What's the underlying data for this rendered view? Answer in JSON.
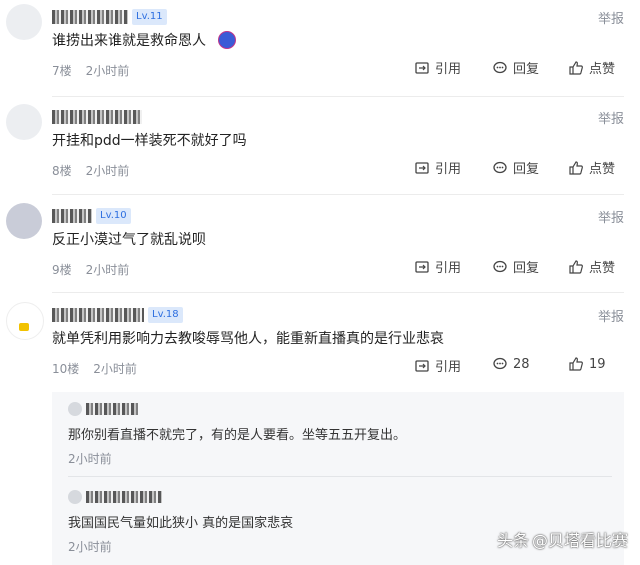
{
  "actions": {
    "report": "举报",
    "quote": "引用",
    "reply": "回复",
    "like": "点赞"
  },
  "comments": [
    {
      "level": "Lv.11",
      "text": "谁捞出来谁就是救命恩人",
      "floor": "7楼",
      "time": "2小时前",
      "reply_count": "回复",
      "like_count": "点赞"
    },
    {
      "level": "",
      "text": "开挂和pdd一样装死不就好了吗",
      "floor": "8楼",
      "time": "2小时前",
      "reply_count": "回复",
      "like_count": "点赞"
    },
    {
      "level": "Lv.10",
      "text": "反正小漠过气了就乱说呗",
      "floor": "9楼",
      "time": "2小时前",
      "reply_count": "回复",
      "like_count": "点赞"
    },
    {
      "level": "Lv.18",
      "text": "就单凭利用影响力去教唆辱骂他人，能重新直播真的是行业悲哀",
      "floor": "10楼",
      "time": "2小时前",
      "reply_count": "28",
      "like_count": "19"
    }
  ],
  "replies": [
    {
      "text": "那你别看直播不就完了，有的是人要看。坐等五五开复出。",
      "time": "2小时前"
    },
    {
      "text": "我国国民气量如此狭小 真的是国家悲哀",
      "time": "2小时前"
    }
  ],
  "watermark": {
    "platform": "头条",
    "author": "@贝塔看比赛"
  },
  "colors": {
    "meta_gray": "#8a8f99",
    "level_blue": "#2e6fe0",
    "reply_bg": "#f6f7f9"
  }
}
